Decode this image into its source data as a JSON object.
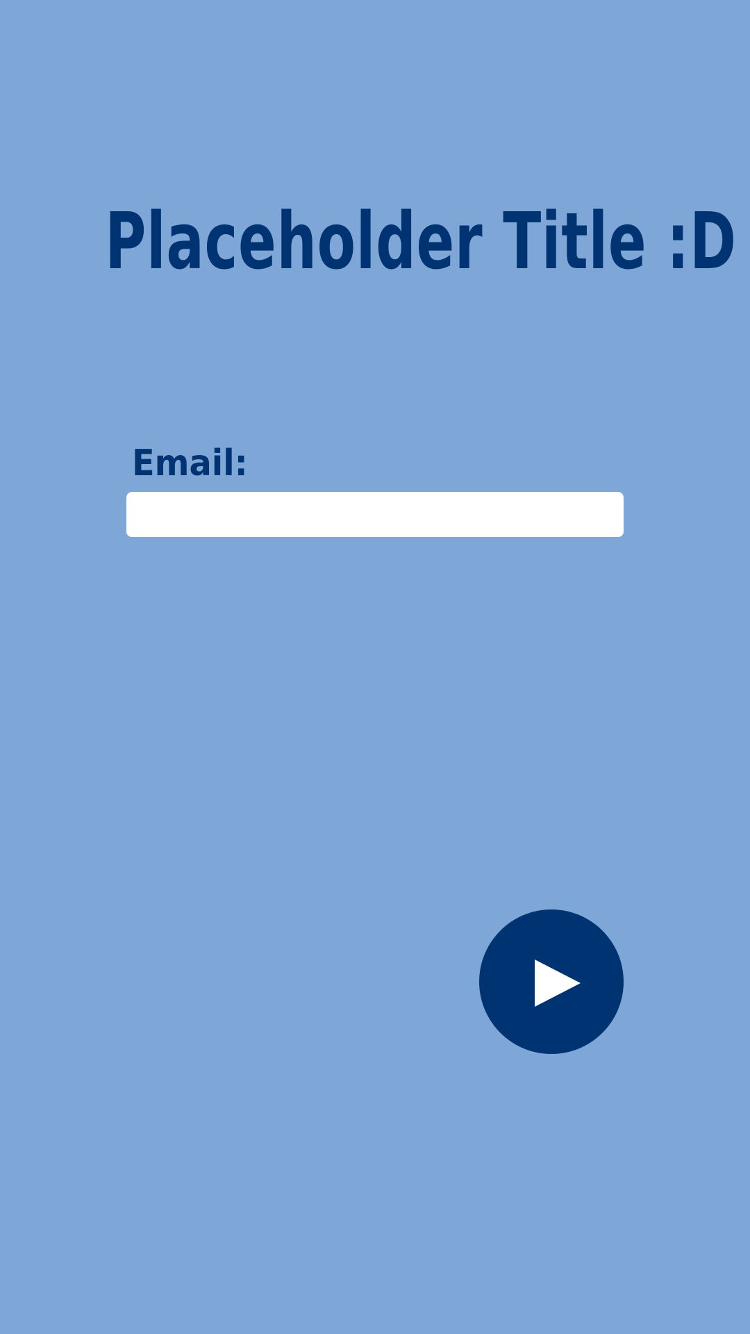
{
  "colors": {
    "background": "#7ea7d8",
    "accent": "#003371",
    "input_background": "#ffffff",
    "icon": "#ffffff"
  },
  "page": {
    "title": "Placeholder Title :D"
  },
  "form": {
    "email_label": "Email:",
    "email_value": "",
    "email_placeholder": ""
  },
  "actions": {
    "next_icon": "play-icon"
  }
}
